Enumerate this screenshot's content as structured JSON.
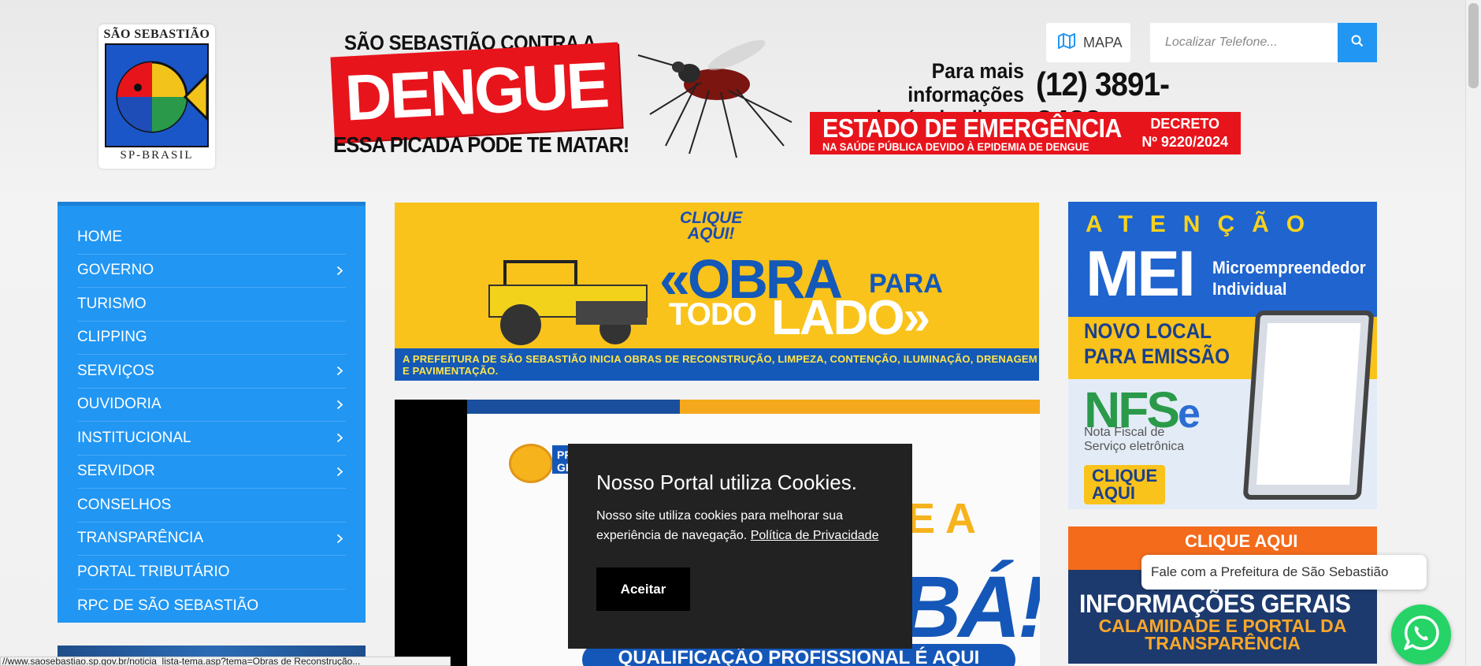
{
  "header": {
    "logo": {
      "top_text": "SÃO SEBASTIÃO",
      "bottom_text": "SP-BRASIL"
    },
    "dengue": {
      "top_line": "SÃO SEBASTIÃO CONTRA A",
      "title": "DENGUE",
      "subtitle": "ESSA PICADA PODE TE MATAR!",
      "info_line1": "Para mais informações",
      "info_line2": "e denúncias ligue:",
      "phone": "(12) 3891-3423",
      "emergency_title": "ESTADO DE EMERGÊNCIA",
      "emergency_sub": "NA SAÚDE PÚBLICA DEVIDO À EPIDEMIA DE DENGUE",
      "decreto_line1": "DECRETO",
      "decreto_line2": "Nº 9220/2024"
    },
    "mapa_label": "MAPA",
    "search_placeholder": "Localizar Telefone..."
  },
  "sidebar": {
    "items": [
      {
        "label": "HOME",
        "has_submenu": false
      },
      {
        "label": "GOVERNO",
        "has_submenu": true
      },
      {
        "label": "TURISMO",
        "has_submenu": false
      },
      {
        "label": "CLIPPING",
        "has_submenu": false
      },
      {
        "label": "SERVIÇOS",
        "has_submenu": true
      },
      {
        "label": "OUVIDORIA",
        "has_submenu": true
      },
      {
        "label": "INSTITUCIONAL",
        "has_submenu": true
      },
      {
        "label": "SERVIDOR",
        "has_submenu": true
      },
      {
        "label": "CONSELHOS",
        "has_submenu": false
      },
      {
        "label": "TRANSPARÊNCIA",
        "has_submenu": true
      },
      {
        "label": "PORTAL TRIBUTÁRIO",
        "has_submenu": false
      },
      {
        "label": "RPC DE SÃO SEBASTIÃO",
        "has_submenu": false
      }
    ]
  },
  "banners": {
    "obra": {
      "click_line1": "CLIQUE",
      "click_line2": "AQUI!",
      "obra": "«OBRA",
      "para": "PARA",
      "todo": "TODO",
      "lado": "LADO»",
      "footer": "A PREFEITURA DE SÃO SEBASTIÃO INICIA OBRAS DE RECONSTRUÇÃO, LIMPEZA, CONTENÇÃO, ILUMINAÇÃO, DRENAGEM E PAVIMENTAÇÃO."
    },
    "qualificacao": {
      "pill": "PRO GR",
      "ea": "E A",
      "ba": "BÁ!",
      "bottom": "QUALIFICAÇÃO PROFISSIONAL É AQUI"
    },
    "mei": {
      "atencao": "ATENÇÃO",
      "mei": "MEI",
      "micro_line1": "Microempreendedor",
      "micro_line2": "Individual",
      "novo_line1": "NOVO LOCAL",
      "novo_line2": "PARA EMISSÃO",
      "nfs": "NFS",
      "nfs_e": "e",
      "nota_line1": "Nota Fiscal de",
      "nota_line2": "Serviço eletrônica",
      "clique_line1": "CLIQUE",
      "clique_line2": "AQUI"
    },
    "info": {
      "click": "CLIQUE AQUI",
      "title": "INFORMAÇÕES GERAIS",
      "sub_line1": "CALAMIDADE E PORTAL DA",
      "sub_line2": "TRANSPARÊNCIA"
    }
  },
  "cookie": {
    "title": "Nosso Portal utiliza Cookies.",
    "text": "Nosso site utiliza cookies para melhorar sua experiência de navegação.",
    "link": "Política de Privacidade",
    "button": "Aceitar"
  },
  "whatsapp": {
    "bubble": "Fale com a Prefeitura de São Sebastião"
  },
  "status_bar": {
    "url": "//www.saosebastiao.sp.gov.br/noticia_lista-tema.asp?tema=Obras de Reconstrução..."
  },
  "colors": {
    "accent": "#2196f3",
    "dengue_red": "#e8141c",
    "whatsapp": "#25d366"
  }
}
